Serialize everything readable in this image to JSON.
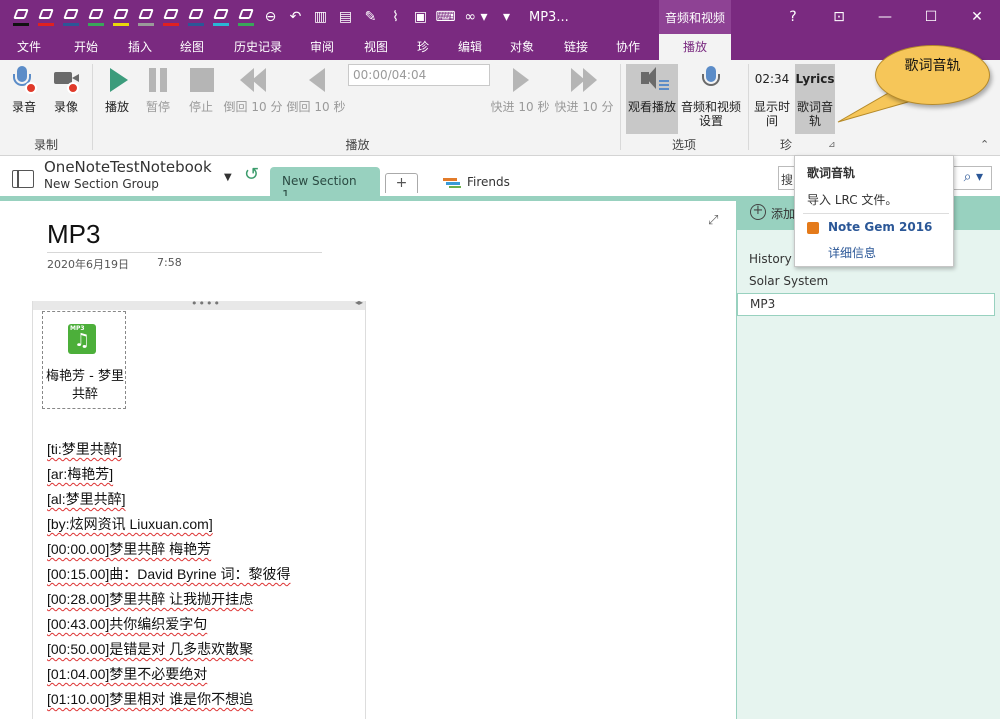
{
  "titlebar": {
    "title": "MP3...",
    "context_tab": "音频和视频",
    "help": "?",
    "pen_colors": [
      "#e02020",
      "#e02020",
      "#2b5797",
      "#3aa65a",
      "#e9d70a",
      "#7a7a7a",
      "#e02020",
      "#2b5797",
      "#29b6d6",
      "#3aa65a"
    ]
  },
  "tabs": [
    {
      "label": "文件"
    },
    {
      "label": "开始"
    },
    {
      "label": "插入"
    },
    {
      "label": "绘图"
    },
    {
      "label": "历史记录"
    },
    {
      "label": "审阅"
    },
    {
      "label": "视图"
    },
    {
      "label": "珍"
    },
    {
      "label": "编辑"
    },
    {
      "label": "对象"
    },
    {
      "label": "链接"
    },
    {
      "label": "协作"
    },
    {
      "label": "播放"
    }
  ],
  "ribbon": {
    "record_audio": "录音",
    "record_video": "录像",
    "group_record": "录制",
    "play": "播放",
    "pause": "暂停",
    "stop": "停止",
    "rewind10m": "倒回 10 分",
    "rewind10s": "倒回 10 秒",
    "time_value": "00:00/04:04",
    "forward10s": "快进 10 秒",
    "forward10m": "快进 10 分",
    "group_playback": "播放",
    "see_playback": "观看播放",
    "av_settings": "音频和视频设置",
    "group_options": "选项",
    "show_time_top": "02:34",
    "show_time": "显示时间",
    "lyrics_top": "Lyrics",
    "lyrics": "歌词音轨",
    "group_zhen": "珍"
  },
  "notebook": {
    "name": "OneNoteTestNotebook",
    "section_group": "New Section Group",
    "active_section": "New Section 1",
    "add_section": "+",
    "other_section": "Firends",
    "search_text": "搜"
  },
  "page": {
    "title": "MP3",
    "date": "2020年6月19日",
    "time": "7:58",
    "attachment_name": "梅艳芳 - 梦里共醉",
    "mp3_tag": "MP3",
    "lyrics": [
      "[ti:梦里共醉]",
      "[ar:梅艳芳]",
      "[al:梦里共醉]",
      "[by:炫网资讯 Liuxuan.com]",
      "[00:00.00]梦里共醉 梅艳芳",
      "[00:15.00]曲：David Byrine  词：黎彼得",
      "[00:28.00]梦里共醉 让我抛开挂虑",
      "[00:43.00]共你编织爱字句",
      "[00:50.00]是错是对 几多悲欢散聚",
      "[01:04.00]梦里不必要绝对",
      "[01:10.00]梦里相对 谁是你不想追"
    ]
  },
  "pages_pane": {
    "add_page": "添加",
    "items": [
      "History",
      "Solar System",
      "MP3"
    ]
  },
  "popup": {
    "header": "歌词音轨",
    "import": "导入 LRC 文件。",
    "gem_title": "Note Gem 2016",
    "details": "详细信息"
  },
  "callout": {
    "text": "歌词音轨"
  }
}
